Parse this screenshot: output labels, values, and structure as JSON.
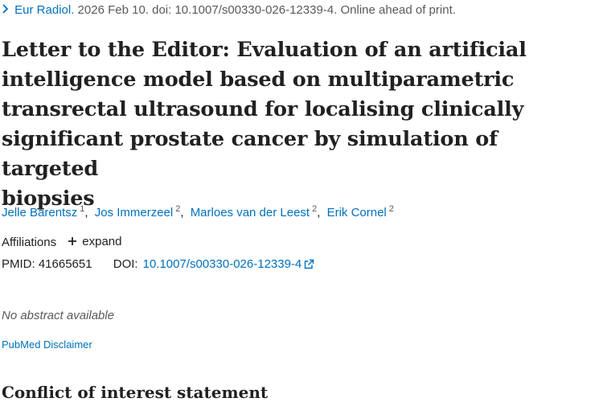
{
  "citation": {
    "journal": "Eur Radiol.",
    "details": "2026 Feb 10. doi: 10.1007/s00330-026-12339-4. Online ahead of print."
  },
  "article": {
    "title_lines": [
      "Letter to the Editor: Evaluation of an artificial",
      "intelligence model based on multiparametric",
      "transrectal ultrasound for localising clinically",
      "significant prostate cancer by simulation of targeted",
      "biopsies"
    ]
  },
  "authors": [
    {
      "name": "Jelle Barentsz",
      "aff": "1"
    },
    {
      "name": "Jos Immerzeel",
      "aff": "2"
    },
    {
      "name": "Marloes van der Leest",
      "aff": "2"
    },
    {
      "name": "Erik Cornel",
      "aff": "2"
    }
  ],
  "affiliations": {
    "label": "Affiliations",
    "expand_label": "expand"
  },
  "identifiers": {
    "pmid_label": "PMID:",
    "pmid": "41665651",
    "doi_label": "DOI:",
    "doi": "10.1007/s00330-026-12339-4"
  },
  "abstract": {
    "none_text": "No abstract available"
  },
  "disclaimer": {
    "label": "PubMed Disclaimer"
  },
  "sections": {
    "coi_heading": "Conflict of interest statement"
  },
  "colors": {
    "link": "#0071bc",
    "text": "#212121",
    "muted": "#5a5a5a"
  },
  "icons": {
    "citation_chevron": "chevron-right-icon",
    "expand": "plus-icon",
    "doi_external": "external-link-icon"
  }
}
